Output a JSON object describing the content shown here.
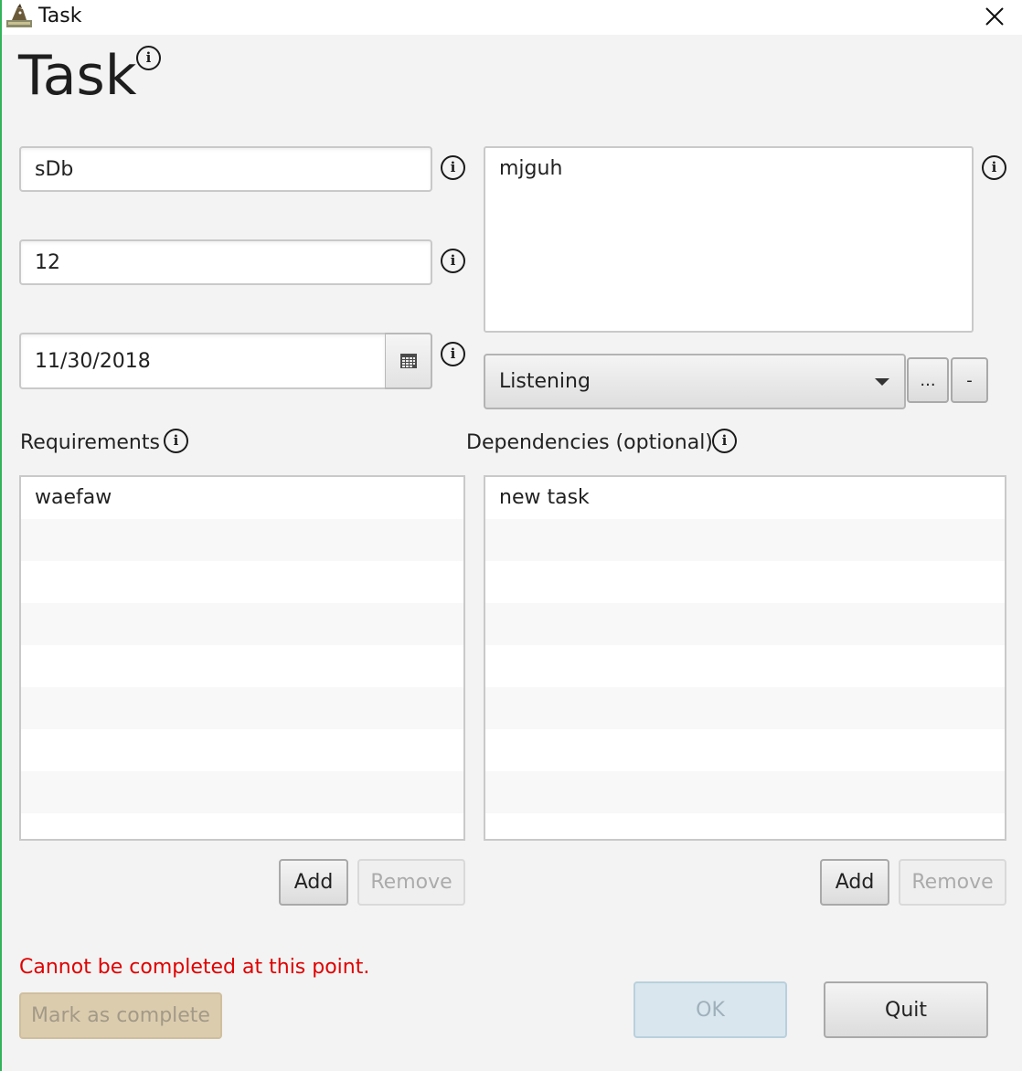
{
  "window": {
    "title": "Task",
    "icon": "app-mascot-icon",
    "close_icon": "close-icon"
  },
  "heading": {
    "text": "Task",
    "info_icon": "info-icon"
  },
  "form": {
    "name_value": "sDb",
    "number_value": "12",
    "date_value": "11/30/2018",
    "calendar_icon": "calendar-icon",
    "description_value": "mjguh",
    "category_selected": "Listening",
    "more_button_label": "...",
    "minus_button_label": "-",
    "info_glyph": "i"
  },
  "requirements": {
    "label": "Requirements",
    "rows": [
      "waefaw",
      "",
      "",
      "",
      "",
      "",
      "",
      ""
    ],
    "add_label": "Add",
    "remove_label": "Remove"
  },
  "dependencies": {
    "label": "Dependencies (optional)",
    "rows": [
      "new task",
      "",
      "",
      "",
      "",
      "",
      "",
      ""
    ],
    "add_label": "Add",
    "remove_label": "Remove"
  },
  "status": {
    "error_message": "Cannot be completed at this point.",
    "error_color": "#e00000"
  },
  "footer": {
    "mark_complete_label": "Mark as complete",
    "ok_label": "OK",
    "quit_label": "Quit"
  }
}
